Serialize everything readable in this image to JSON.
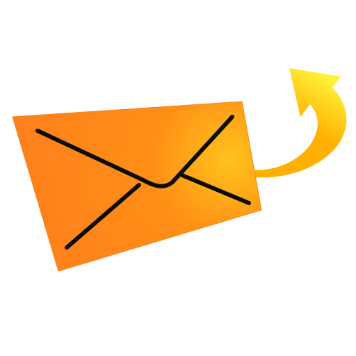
{
  "icon": {
    "name": "send-mail-icon",
    "parts": {
      "envelope": "envelope-icon",
      "arrow": "curved-arrow-icon"
    }
  },
  "colors": {
    "envelope_highlight": "#ffc21a",
    "envelope_mid": "#ff8f16",
    "envelope_dark": "#ff7f1c",
    "envelope_edge": "#f5851e",
    "fold_lines": "#0b0b0b",
    "arrow_light": "#fff23a",
    "arrow_dark": "#ffb000",
    "background": "#ffffff"
  }
}
